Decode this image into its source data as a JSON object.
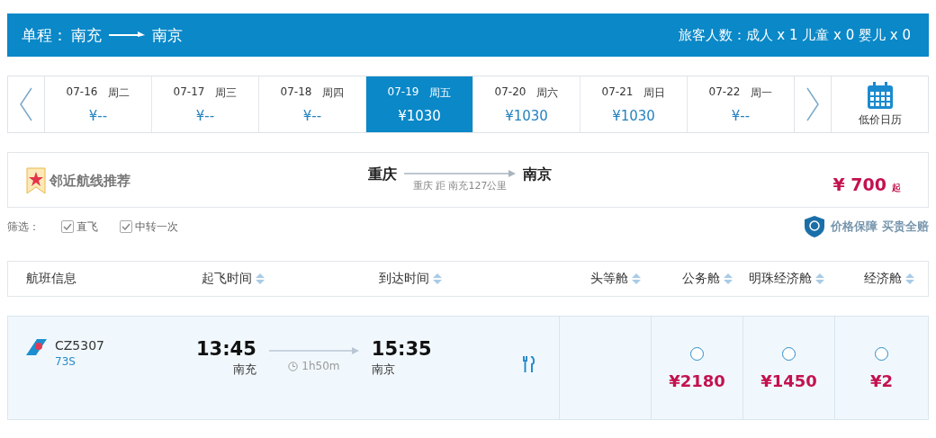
{
  "header": {
    "trip_type": "单程：",
    "origin": "南充",
    "destination": "南京",
    "passengers": "旅客人数：成人 x 1 儿童 x 0 婴儿 x 0"
  },
  "dates": [
    {
      "date": "07-16",
      "weekday": "周二",
      "price": "¥--",
      "selected": false
    },
    {
      "date": "07-17",
      "weekday": "周三",
      "price": "¥--",
      "selected": false
    },
    {
      "date": "07-18",
      "weekday": "周四",
      "price": "¥--",
      "selected": false
    },
    {
      "date": "07-19",
      "weekday": "周五",
      "price": "¥1030",
      "selected": true
    },
    {
      "date": "07-20",
      "weekday": "周六",
      "price": "¥1030",
      "selected": false
    },
    {
      "date": "07-21",
      "weekday": "周日",
      "price": "¥1030",
      "selected": false
    },
    {
      "date": "07-22",
      "weekday": "周一",
      "price": "¥--",
      "selected": false
    }
  ],
  "calendar_label": "低价日历",
  "recommendation": {
    "title": "邻近航线推荐",
    "from": "重庆",
    "to": "南京",
    "note": "重庆 距 南充127公里",
    "price": "¥ 700",
    "price_suffix": "起"
  },
  "filters": {
    "label": "筛选：",
    "options": [
      {
        "label": "直飞",
        "checked": true
      },
      {
        "label": "中转一次",
        "checked": true
      }
    ],
    "guarantee": "价格保障 买贵全赔"
  },
  "columns": [
    {
      "label": "航班信息",
      "sortable": false
    },
    {
      "label": "起飞时间",
      "sortable": true
    },
    {
      "label": "到达时间",
      "sortable": true
    },
    {
      "label": "头等舱",
      "sortable": true
    },
    {
      "label": "公务舱",
      "sortable": true
    },
    {
      "label": "明珠经济舱",
      "sortable": true
    },
    {
      "label": "经济舱",
      "sortable": true
    }
  ],
  "flight": {
    "number": "CZ5307",
    "aircraft": "73S",
    "depart_time": "13:45",
    "depart_city": "南充",
    "duration": "1h50m",
    "arrive_time": "15:35",
    "arrive_city": "南京",
    "meal": true,
    "fares": [
      {
        "price": "¥2180",
        "selected": false
      },
      {
        "price": "¥1450",
        "selected": false
      },
      {
        "price": "¥2",
        "selected": false
      }
    ]
  }
}
